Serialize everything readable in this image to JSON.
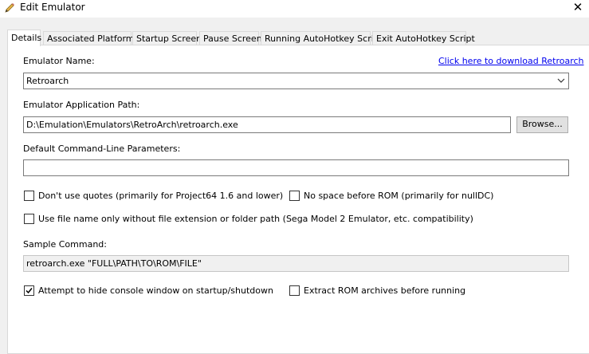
{
  "window": {
    "title": "Edit Emulator",
    "close_glyph": "✕"
  },
  "tabs": [
    {
      "label": "Details"
    },
    {
      "label": "Associated Platforms"
    },
    {
      "label": "Startup Screen"
    },
    {
      "label": "Pause Screen"
    },
    {
      "label": "Running AutoHotkey Script"
    },
    {
      "label": "Exit AutoHotkey Script"
    }
  ],
  "details": {
    "emulator_name_label": "Emulator Name:",
    "download_link": "Click here to download Retroarch",
    "emulator_name_value": "Retroarch",
    "app_path_label": "Emulator Application Path:",
    "app_path_value": "D:\\Emulation\\Emulators\\RetroArch\\retroarch.exe",
    "browse_label": "Browse...",
    "cmdline_label": "Default Command-Line Parameters:",
    "cmdline_value": "",
    "options": {
      "no_quotes": {
        "label": "Don't use quotes (primarily for Project64 1.6 and lower)",
        "checked": false
      },
      "no_space": {
        "label": "No space before ROM (primarily for nullDC)",
        "checked": false
      },
      "file_name_only": {
        "label": "Use file name only without file extension or folder path (Sega Model 2 Emulator, etc. compatibility)",
        "checked": false
      },
      "hide_console": {
        "label": "Attempt to hide console window on startup/shutdown",
        "checked": true
      },
      "extract_rom": {
        "label": "Extract ROM archives before running",
        "checked": false
      }
    },
    "sample_label": "Sample Command:",
    "sample_value": "retroarch.exe \"FULL\\PATH\\TO\\ROM\\FILE\""
  }
}
